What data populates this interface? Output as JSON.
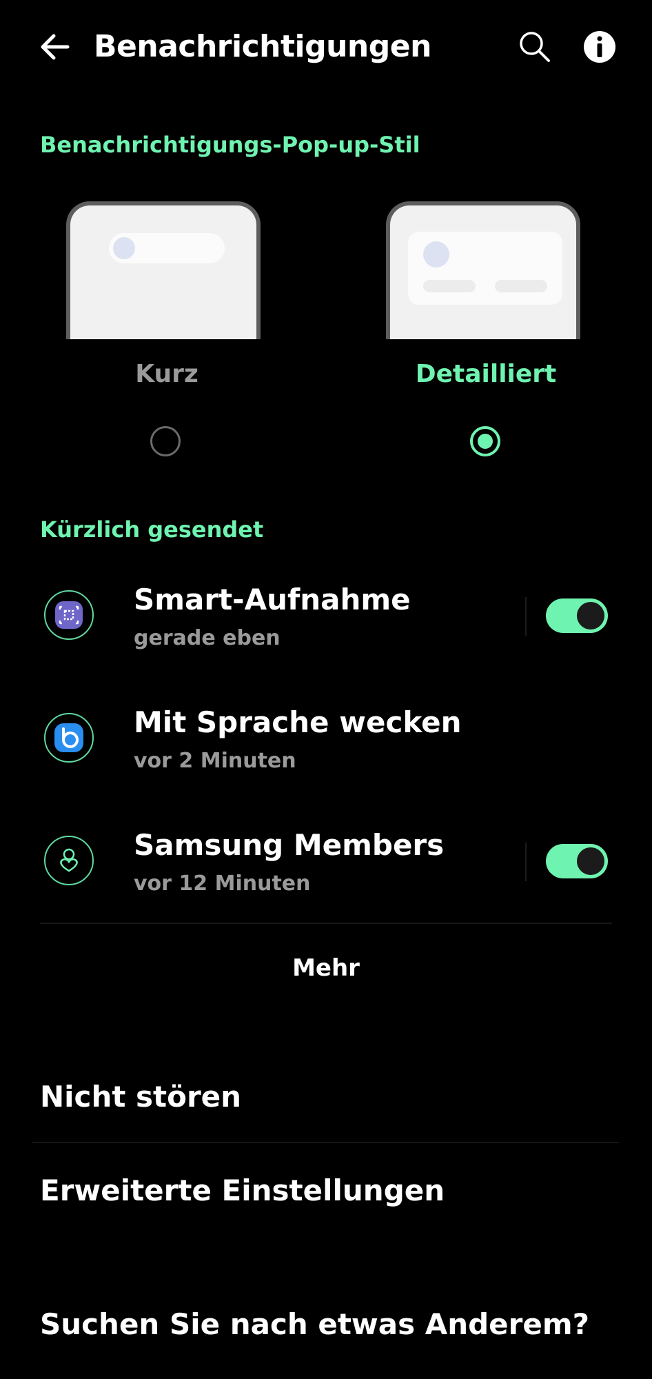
{
  "colors": {
    "accent": "#6ff3b0",
    "background": "#000000",
    "text_primary": "#ffffff",
    "text_secondary": "#9a9a9a"
  },
  "header": {
    "title": "Benachrichtigungen",
    "back_icon": "arrow-left-icon",
    "search_icon": "search-icon",
    "info_icon": "info-icon"
  },
  "popup_style": {
    "section_label": "Benachrichtigungs-Pop-up-Stil",
    "options": [
      {
        "label": "Kurz",
        "selected": false
      },
      {
        "label": "Detailliert",
        "selected": true
      }
    ]
  },
  "recent": {
    "section_label": "Kürzlich gesendet",
    "apps": [
      {
        "name": "Smart-Aufnahme",
        "time": "gerade eben",
        "icon": "smart-capture-icon",
        "toggle": true,
        "enabled": true
      },
      {
        "name": "Mit Sprache wecken",
        "time": "vor 2 Minuten",
        "icon": "bixby-icon",
        "toggle": false
      },
      {
        "name": "Samsung Members",
        "time": "vor 12 Minuten",
        "icon": "samsung-members-icon",
        "toggle": true,
        "enabled": true
      }
    ],
    "more_label": "Mehr"
  },
  "menu": {
    "do_not_disturb": "Nicht stören",
    "advanced": "Erweiterte Einstellungen"
  },
  "footer": {
    "looking_for": "Suchen Sie nach etwas Anderem?"
  }
}
